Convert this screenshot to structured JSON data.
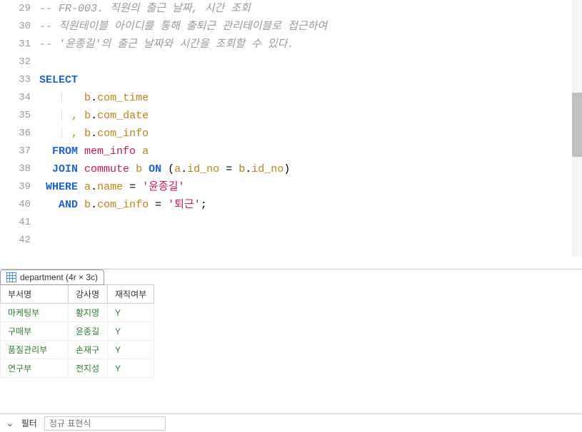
{
  "editor": {
    "startLine": 29,
    "lines": [
      {
        "n": 29,
        "html": "<span class='comment'>-- FR-003. 직원의 출근 날짜, 시간 조회</span>"
      },
      {
        "n": 30,
        "html": "<span class='comment'>-- 직원테이블 아이디를 통해 출퇴근 관리테이블로 접근하여</span>"
      },
      {
        "n": 31,
        "html": "<span class='comment'>-- '윤종길'의 출근 날짜와 시간을 조회할 수 있다.</span>"
      },
      {
        "n": 32,
        "html": ""
      },
      {
        "n": 33,
        "html": "<span class='keyword'>SELECT</span>"
      },
      {
        "n": 34,
        "html": "   <span class='guide'>|</span>   <span class='field'>b</span>.<span class='field'>com_time</span>"
      },
      {
        "n": 35,
        "html": "   <span class='guide'>|</span> <span class='punct'>,</span> <span class='field'>b</span>.<span class='field'>com_date</span>"
      },
      {
        "n": 36,
        "html": "   <span class='guide'>|</span> <span class='punct'>,</span> <span class='field'>b</span>.<span class='field'>com_info</span>"
      },
      {
        "n": 37,
        "html": "  <span class='keyword'>FROM</span> <span class='tablename'>mem_info</span> <span class='alias'>a</span>"
      },
      {
        "n": 38,
        "html": "  <span class='keyword'>JOIN</span> <span class='tablename'>commute</span> <span class='alias'>b</span> <span class='keyword'>ON</span> (<span class='field'>a</span>.<span class='field'>id_no</span> = <span class='field'>b</span>.<span class='field'>id_no</span>)"
      },
      {
        "n": 39,
        "html": " <span class='keyword'>WHERE</span> <span class='field'>a</span>.<span class='field'>name</span> = <span class='string'>'윤종길'</span>"
      },
      {
        "n": 40,
        "html": "   <span class='keyword'>AND</span> <span class='field'>b</span>.<span class='field'>com_info</span> = <span class='string'>'퇴근'</span>;"
      },
      {
        "n": 41,
        "html": ""
      },
      {
        "n": 42,
        "html": ""
      }
    ]
  },
  "results": {
    "tabLabel": "department (4r × 3c)",
    "headers": [
      "부서명",
      "강사명",
      "재직여부"
    ],
    "rows": [
      [
        "마케팅부",
        "황지영",
        "Y"
      ],
      [
        "구매부",
        "윤종길",
        "Y"
      ],
      [
        "품질관리부",
        "손재구",
        "Y"
      ],
      [
        "연구부",
        "전지성",
        "Y"
      ]
    ]
  },
  "bottomBar": {
    "label": "필터",
    "placeholder": "정규 표현식"
  }
}
